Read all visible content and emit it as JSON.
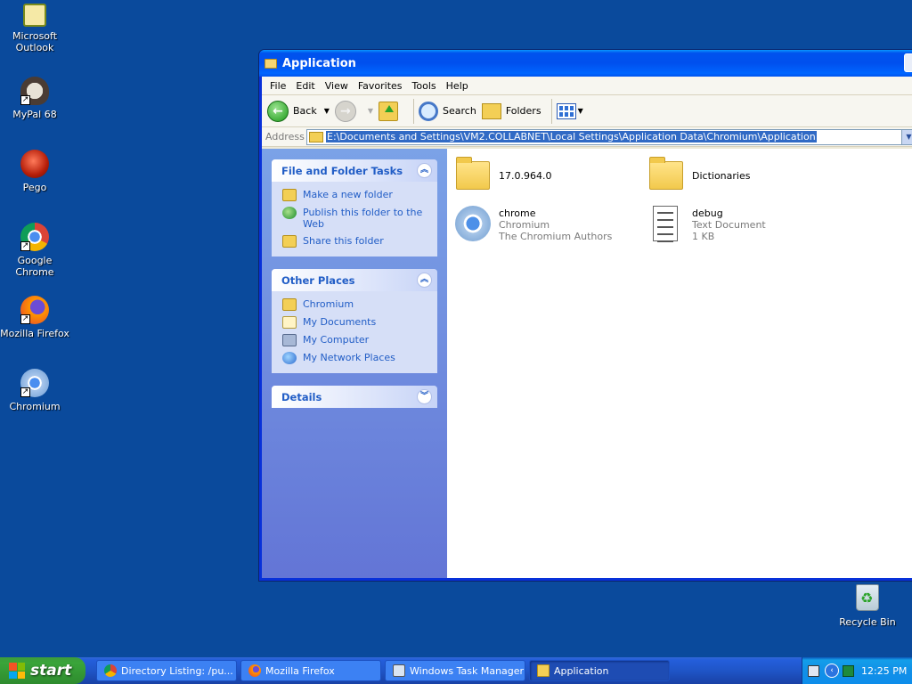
{
  "desktop": {
    "icons": [
      {
        "label": "Microsoft Outlook",
        "icon": "outlook-icon"
      },
      {
        "label": "MyPal 68",
        "icon": "mypal-icon"
      },
      {
        "label": "Pego",
        "icon": "pego-icon"
      },
      {
        "label": "Google Chrome",
        "icon": "chrome-icon"
      },
      {
        "label": "Mozilla Firefox",
        "icon": "firefox-icon"
      },
      {
        "label": "Chromium",
        "icon": "chromium-icon"
      }
    ],
    "recycle_bin": "Recycle Bin"
  },
  "window": {
    "title": "Application",
    "menu": [
      "File",
      "Edit",
      "View",
      "Favorites",
      "Tools",
      "Help"
    ],
    "toolbar": {
      "back": "Back",
      "search": "Search",
      "folders": "Folders"
    },
    "address": {
      "label": "Address",
      "value": "E:\\Documents and Settings\\VM2.COLLABNET\\Local Settings\\Application Data\\Chromium\\Application"
    },
    "taskpane": {
      "file_tasks": {
        "title": "File and Folder Tasks",
        "items": [
          "Make a new folder",
          "Publish this folder to the Web",
          "Share this folder"
        ]
      },
      "other_places": {
        "title": "Other Places",
        "items": [
          "Chromium",
          "My Documents",
          "My Computer",
          "My Network Places"
        ]
      },
      "details": {
        "title": "Details"
      }
    },
    "files": [
      {
        "name": "17.0.964.0",
        "type": "folder"
      },
      {
        "name": "Dictionaries",
        "type": "folder"
      },
      {
        "name": "chrome",
        "line2": "Chromium",
        "line3": "The Chromium Authors",
        "type": "app"
      },
      {
        "name": "debug",
        "line2": "Text Document",
        "line3": "1 KB",
        "type": "text"
      }
    ]
  },
  "taskbar": {
    "start": "start",
    "buttons": [
      {
        "label": "Directory Listing: /pu...",
        "icon": "chrome-icon"
      },
      {
        "label": "Mozilla Firefox",
        "icon": "firefox-icon"
      },
      {
        "label": "Windows Task Manager",
        "icon": "task-manager-icon"
      },
      {
        "label": "Application",
        "icon": "folder-icon",
        "active": true
      }
    ],
    "clock": "12:25 PM"
  }
}
